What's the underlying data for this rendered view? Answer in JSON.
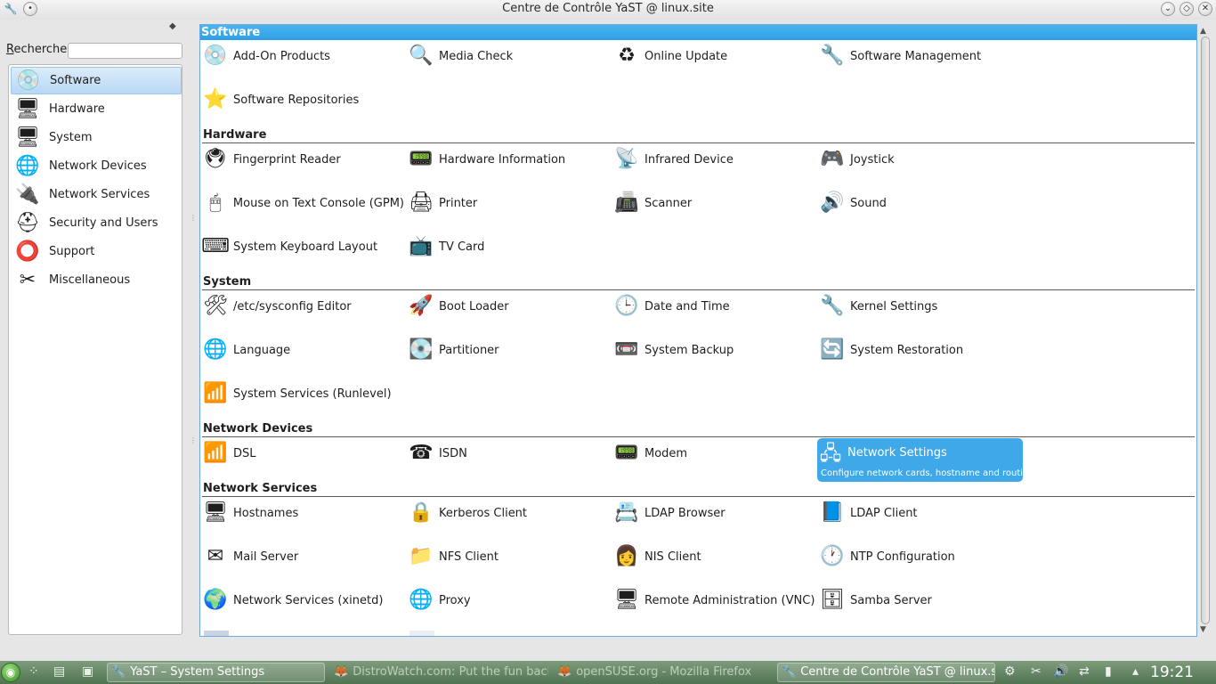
{
  "window": {
    "title": "Centre de Contrôle YaST @ linux.site"
  },
  "search": {
    "label_first": "R",
    "label_rest": "echerche",
    "value": ""
  },
  "categories": [
    {
      "label": "Software",
      "icon": "software-icon",
      "glyph": "💿",
      "selected": true
    },
    {
      "label": "Hardware",
      "icon": "hardware-icon",
      "glyph": "🖥",
      "selected": false
    },
    {
      "label": "System",
      "icon": "system-icon",
      "glyph": "🖥",
      "selected": false
    },
    {
      "label": "Network Devices",
      "icon": "network-devices-icon",
      "glyph": "🌐",
      "selected": false
    },
    {
      "label": "Network Services",
      "icon": "network-services-icon",
      "glyph": "🔌",
      "selected": false
    },
    {
      "label": "Security and Users",
      "icon": "security-icon",
      "glyph": "⛑",
      "selected": false
    },
    {
      "label": "Support",
      "icon": "support-icon",
      "glyph": "⭕",
      "selected": false
    },
    {
      "label": "Miscellaneous",
      "icon": "miscellaneous-icon",
      "glyph": "✂",
      "selected": false
    }
  ],
  "sections": {
    "software": {
      "title": "Software",
      "modules": [
        {
          "label": "Add-On Products",
          "glyph": "💿"
        },
        {
          "label": "Media Check",
          "glyph": "🔍"
        },
        {
          "label": "Online Update",
          "glyph": "♻"
        },
        {
          "label": "Software Management",
          "glyph": "🔧"
        },
        {
          "label": "Software Repositories",
          "glyph": "⭐"
        }
      ]
    },
    "hardware": {
      "title": "Hardware",
      "modules": [
        {
          "label": "Fingerprint Reader",
          "glyph": "🖲"
        },
        {
          "label": "Hardware Information",
          "glyph": "📟"
        },
        {
          "label": "Infrared Device",
          "glyph": "📡"
        },
        {
          "label": "Joystick",
          "glyph": "🎮"
        },
        {
          "label": "Mouse on Text Console (GPM)",
          "glyph": "🖱"
        },
        {
          "label": "Printer",
          "glyph": "🖨"
        },
        {
          "label": "Scanner",
          "glyph": "📠"
        },
        {
          "label": "Sound",
          "glyph": "🔊"
        },
        {
          "label": "System Keyboard Layout",
          "glyph": "⌨"
        },
        {
          "label": "TV Card",
          "glyph": "📺"
        }
      ]
    },
    "system": {
      "title": "System",
      "modules": [
        {
          "label": "/etc/sysconfig Editor",
          "glyph": "🛠"
        },
        {
          "label": "Boot Loader",
          "glyph": "🚀"
        },
        {
          "label": "Date and Time",
          "glyph": "🕒"
        },
        {
          "label": "Kernel Settings",
          "glyph": "🔧"
        },
        {
          "label": "Language",
          "glyph": "🌐"
        },
        {
          "label": "Partitioner",
          "glyph": "💽"
        },
        {
          "label": "System Backup",
          "glyph": "📼"
        },
        {
          "label": "System Restoration",
          "glyph": "🔄"
        },
        {
          "label": "System Services (Runlevel)",
          "glyph": "📶"
        }
      ]
    },
    "network_devices": {
      "title": "Network Devices",
      "modules": [
        {
          "label": "DSL",
          "glyph": "📶"
        },
        {
          "label": "ISDN",
          "glyph": "☎"
        },
        {
          "label": "Modem",
          "glyph": "📟"
        },
        {
          "label": "Network Settings",
          "glyph": "🖧",
          "description": "Configure network cards, hostname and routing"
        }
      ]
    },
    "network_services": {
      "title": "Network Services",
      "modules": [
        {
          "label": "Hostnames",
          "glyph": "🖥"
        },
        {
          "label": "Kerberos Client",
          "glyph": "🔒"
        },
        {
          "label": "LDAP Browser",
          "glyph": "📇"
        },
        {
          "label": "LDAP Client",
          "glyph": "📘"
        },
        {
          "label": "Mail Server",
          "glyph": "✉"
        },
        {
          "label": "NFS Client",
          "glyph": "📁"
        },
        {
          "label": "NIS Client",
          "glyph": "👩"
        },
        {
          "label": "NTP Configuration",
          "glyph": "🕐"
        },
        {
          "label": "Network Services (xinetd)",
          "glyph": "🌍"
        },
        {
          "label": "Proxy",
          "glyph": "🌐"
        },
        {
          "label": "Remote Administration (VNC)",
          "glyph": "🖥"
        },
        {
          "label": "Samba Server",
          "glyph": "🗄"
        }
      ]
    }
  },
  "taskbar": {
    "tasks": [
      {
        "label": "YaST – System Settings",
        "glyph": "🔧",
        "state": "active"
      },
      {
        "label": "DistroWatch.com: Put the fun back",
        "glyph": "🦊",
        "state": "inactive"
      },
      {
        "label": "openSUSE.org - Mozilla Firefox",
        "glyph": "🦊",
        "state": "inactive"
      },
      {
        "label": "Centre de Contrôle YaST @ linux.site",
        "glyph": "🔧",
        "state": "active"
      }
    ],
    "clock": "19:21"
  }
}
